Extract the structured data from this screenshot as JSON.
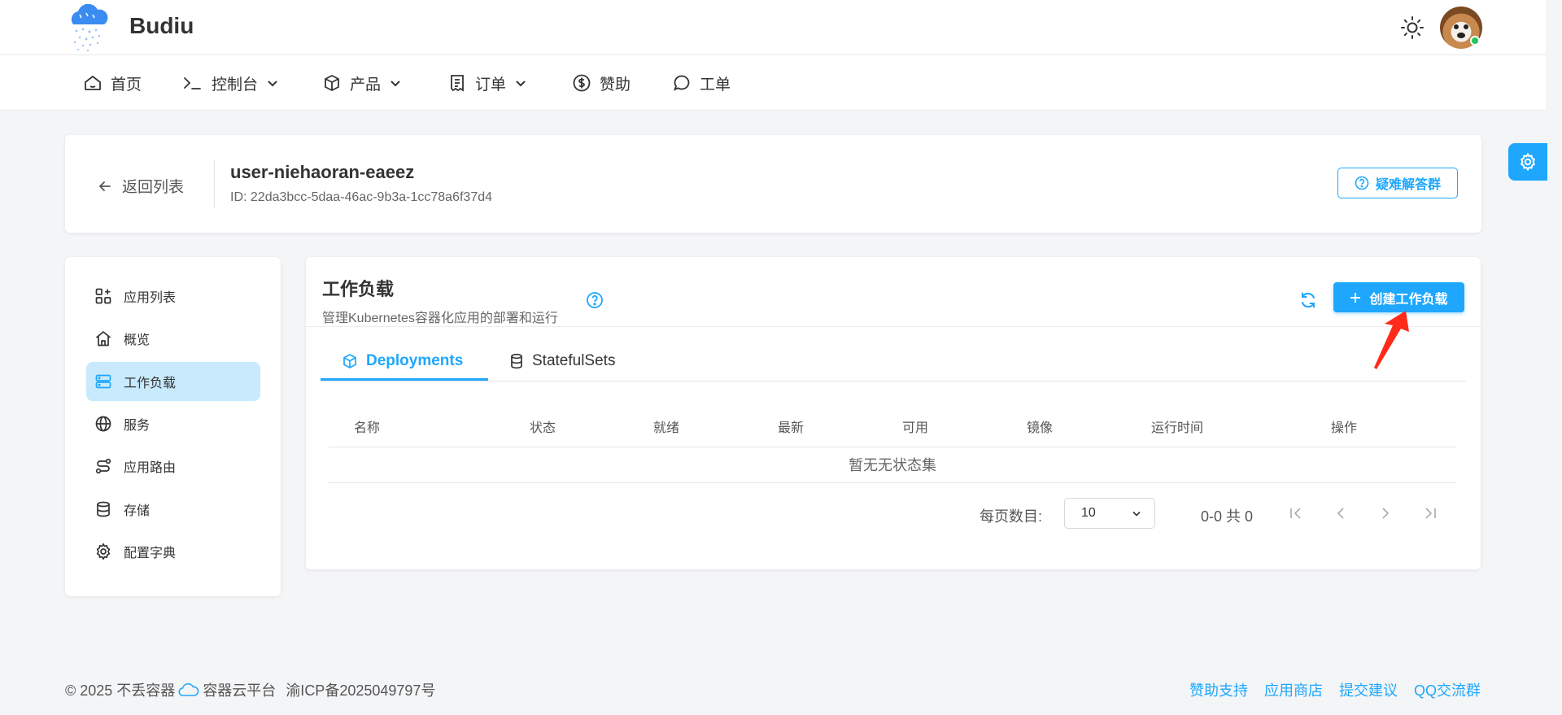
{
  "header": {
    "brand": "Budiu",
    "theme_icon": "sun-icon",
    "avatar": "user-avatar"
  },
  "nav": {
    "items": [
      {
        "label": "首页",
        "icon": "home-icon"
      },
      {
        "label": "控制台",
        "icon": "terminal-icon"
      },
      {
        "label": "产品",
        "icon": "box-icon"
      },
      {
        "label": "订单",
        "icon": "receipt-icon"
      },
      {
        "label": "赞助",
        "icon": "dollar-icon"
      },
      {
        "label": "工单",
        "icon": "chat-icon"
      }
    ]
  },
  "project": {
    "back_label": "返回列表",
    "name": "user-niehaoran-eaeez",
    "id_text": "ID: 22da3bcc-5daa-46ac-9b3a-1cc78a6f37d4",
    "help_button": "疑难解答群"
  },
  "sidebar": {
    "items": [
      {
        "label": "应用列表",
        "icon": "apps-icon"
      },
      {
        "label": "概览",
        "icon": "home-icon"
      },
      {
        "label": "工作负载",
        "icon": "server-icon",
        "active": true
      },
      {
        "label": "服务",
        "icon": "globe-icon"
      },
      {
        "label": "应用路由",
        "icon": "route-icon"
      },
      {
        "label": "存储",
        "icon": "database-icon"
      },
      {
        "label": "配置字典",
        "icon": "gear-icon"
      }
    ]
  },
  "workload": {
    "title": "工作负载",
    "subtitle": "管理Kubernetes容器化应用的部署和运行",
    "create_button": "创建工作负载",
    "tabs": [
      {
        "label": "Deployments",
        "icon": "cube-icon",
        "active": true
      },
      {
        "label": "StatefulSets",
        "icon": "database-icon"
      }
    ],
    "table": {
      "columns": [
        "名称",
        "状态",
        "就绪",
        "最新",
        "可用",
        "镜像",
        "运行时间",
        "操作"
      ],
      "empty_text": "暂无无状态集"
    },
    "pagination": {
      "per_page_label": "每页数目:",
      "per_page_value": "10",
      "range_text": "0-0 共 0"
    }
  },
  "footer": {
    "copyright": "© 2025 不丢容器",
    "platform": "容器云平台",
    "icp": "渝ICP备2025049797号",
    "links": [
      "赞助支持",
      "应用商店",
      "提交建议",
      "QQ交流群"
    ]
  },
  "colors": {
    "accent": "#1ea7fd",
    "active_bg": "#c8eafc",
    "page_bg": "#f4f5f7",
    "annotation": "#ff2a1a"
  }
}
